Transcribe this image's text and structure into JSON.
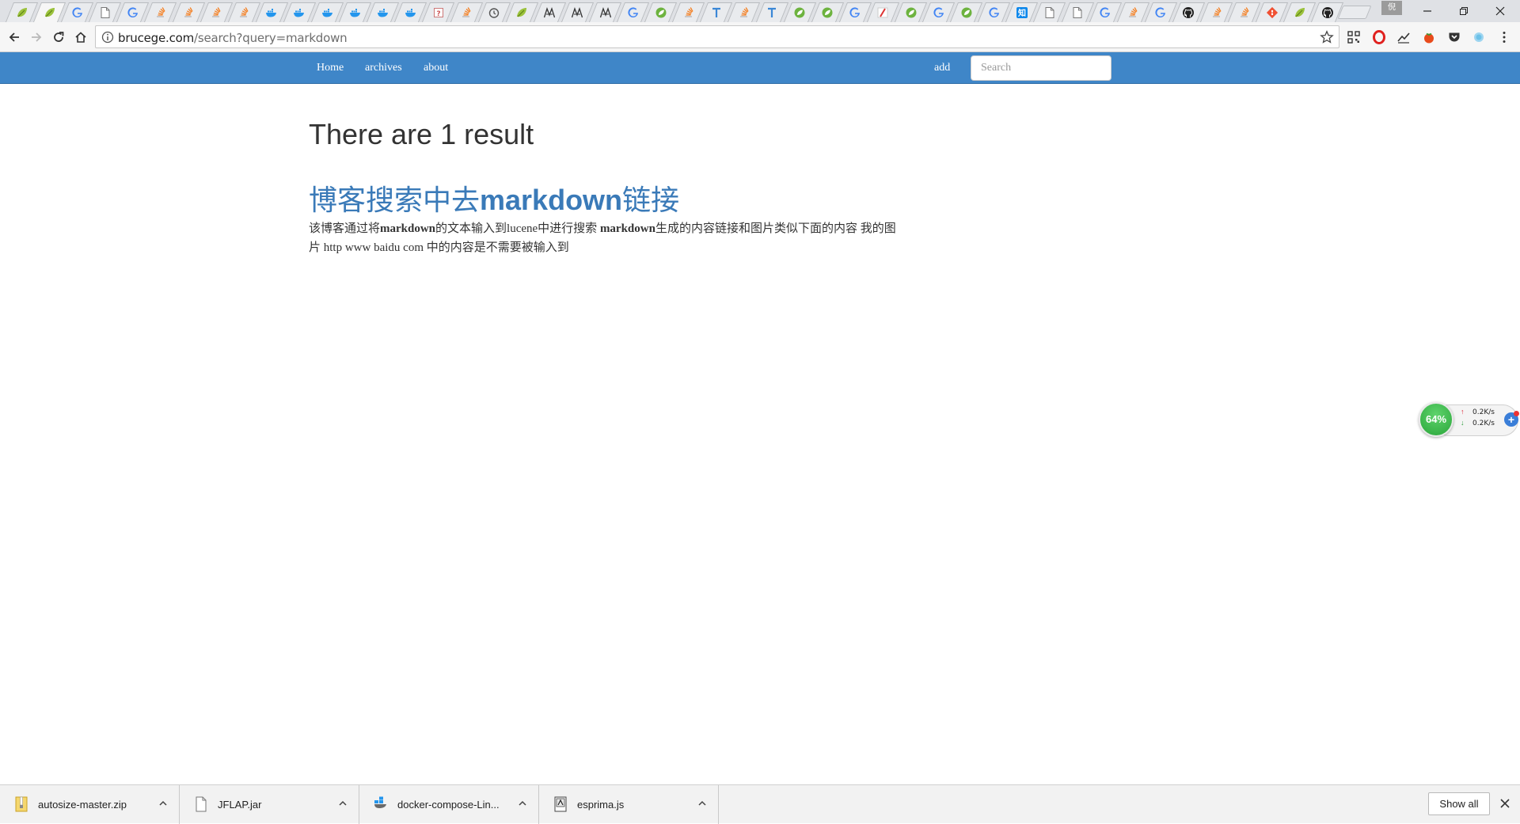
{
  "browser": {
    "tab_icons": [
      "leaf-icon",
      "leaf-icon",
      "google-icon",
      "page-icon",
      "google-icon",
      "stackoverflow-icon",
      "stackoverflow-icon",
      "stackoverflow-icon",
      "stackoverflow-icon",
      "docker-icon",
      "docker-icon",
      "docker-icon",
      "docker-icon",
      "docker-icon",
      "docker-icon",
      "page-warning-icon",
      "stackoverflow-icon",
      "history-icon",
      "leaf-icon",
      "tex-icon",
      "tex-icon",
      "tex-icon",
      "google-icon",
      "spring-icon",
      "stackoverflow-icon",
      "t-icon",
      "stackoverflow-icon",
      "t-icon",
      "spring-icon",
      "spring-icon",
      "google-icon",
      "pen-icon",
      "spring-icon",
      "google-icon",
      "spring-icon",
      "google-icon",
      "zhihu-icon",
      "page-icon",
      "page-icon",
      "google-icon",
      "stackoverflow-icon",
      "google-icon",
      "github-icon",
      "stackoverflow-icon",
      "stackoverflow-icon",
      "git-icon",
      "leaf-icon",
      "github-icon"
    ],
    "active_tab_index": 1,
    "profile_label": "倪",
    "url_host": "brucege.com",
    "url_path": "/search?query=markdown"
  },
  "site_nav": {
    "links": [
      "Home",
      "archives",
      "about"
    ],
    "add_label": "add",
    "search_placeholder": "Search"
  },
  "content": {
    "heading": "There are 1 result",
    "result": {
      "title_prefix": "博客搜索中去",
      "title_keyword": "markdown",
      "title_suffix": "链接",
      "snippet_1": "该博客通过将",
      "snippet_kw1": "markdown",
      "snippet_2": "的文本输入到lucene中进行搜索 ",
      "snippet_kw2": "markdown",
      "snippet_3": "生成的内容链接和图片类似下面的内容 我的图片 http www baidu com 中的内容是不需要被输入到"
    }
  },
  "speed_widget": {
    "percent": "64%",
    "upload": "0.2K/s",
    "download": "0.2K/s"
  },
  "downloads": {
    "items": [
      {
        "name": "autosize-master.zip",
        "icon": "zip-icon"
      },
      {
        "name": "JFLAP.jar",
        "icon": "file-icon"
      },
      {
        "name": "docker-compose-Lin...",
        "icon": "docker-file-icon"
      },
      {
        "name": "esprima.js",
        "icon": "js-file-icon"
      }
    ],
    "show_all_label": "Show all"
  },
  "colors": {
    "nav_blue": "#3f86c8",
    "link_blue": "#3a7ab8",
    "widget_green": "#2aa63a"
  }
}
